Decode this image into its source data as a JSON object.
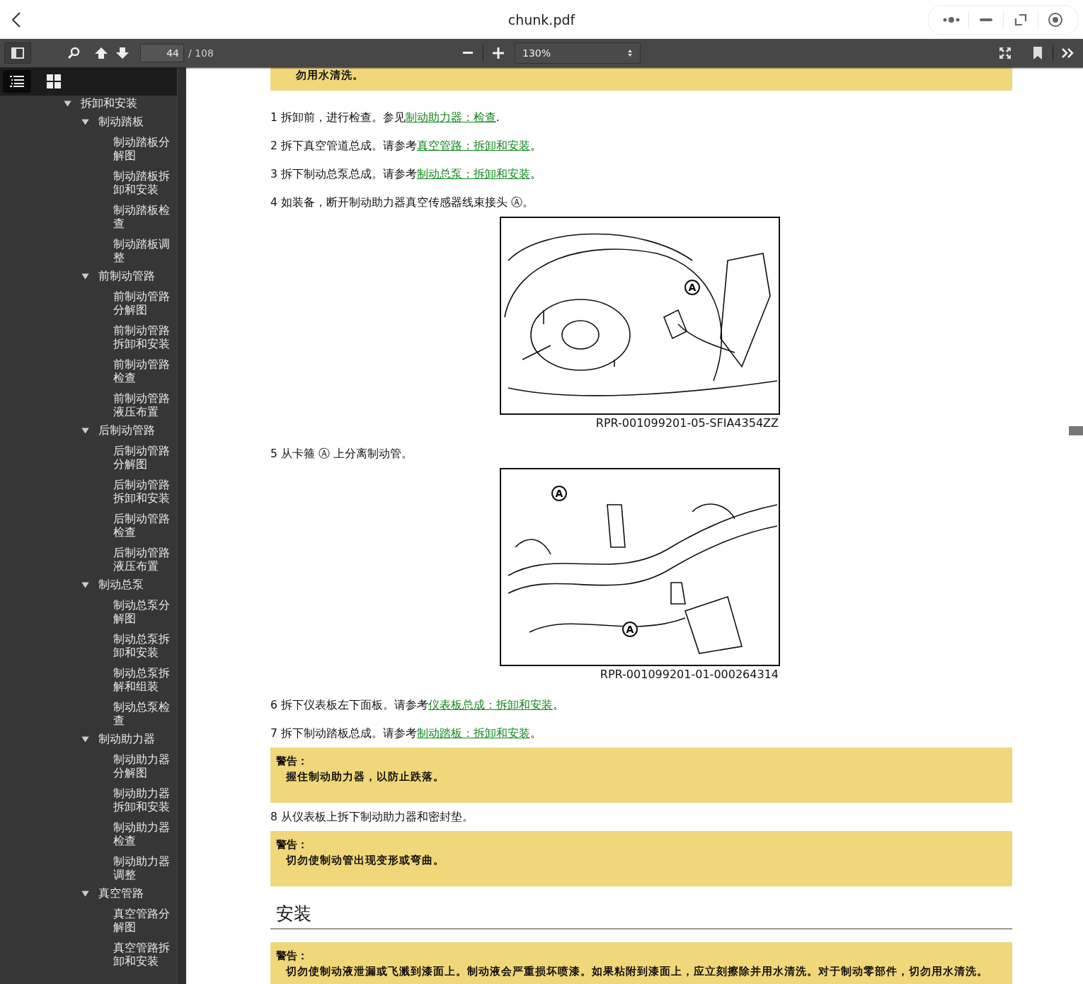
{
  "titlebar": {
    "title": "chunk.pdf"
  },
  "toolbar": {
    "page": "44",
    "page_count": "/ 108",
    "zoom": "130%"
  },
  "sidebar": {
    "tabs": [
      {
        "kind": "outline",
        "selected": true
      },
      {
        "kind": "thumbnails",
        "selected": false
      }
    ],
    "outline": [
      {
        "label": "拆卸和安装",
        "expanded": true,
        "children": [
          {
            "label": "制动踏板",
            "expanded": true,
            "children": [
              {
                "label": "制动踏板分解图"
              },
              {
                "label": "制动踏板拆卸和安装"
              },
              {
                "label": "制动踏板检查"
              },
              {
                "label": "制动踏板调整"
              }
            ]
          },
          {
            "label": "前制动管路",
            "expanded": true,
            "children": [
              {
                "label": "前制动管路分解图"
              },
              {
                "label": "前制动管路拆卸和安装"
              },
              {
                "label": "前制动管路检查"
              },
              {
                "label": "前制动管路液压布置"
              }
            ]
          },
          {
            "label": "后制动管路",
            "expanded": true,
            "children": [
              {
                "label": "后制动管路分解图"
              },
              {
                "label": "后制动管路拆卸和安装"
              },
              {
                "label": "后制动管路检查"
              },
              {
                "label": "后制动管路液压布置"
              }
            ]
          },
          {
            "label": "制动总泵",
            "expanded": true,
            "children": [
              {
                "label": "制动总泵分解图"
              },
              {
                "label": "制动总泵拆卸和安装"
              },
              {
                "label": "制动总泵拆解和组装"
              },
              {
                "label": "制动总泵检查"
              }
            ]
          },
          {
            "label": "制动助力器",
            "expanded": true,
            "children": [
              {
                "label": "制动助力器分解图"
              },
              {
                "label": "制动助力器拆卸和安装"
              },
              {
                "label": "制动助力器检查"
              },
              {
                "label": "制动助力器调整"
              }
            ]
          },
          {
            "label": "真空管路",
            "expanded": true,
            "children": [
              {
                "label": "真空管路分解图"
              },
              {
                "label": "真空管路拆卸和安装"
              }
            ]
          }
        ]
      }
    ]
  },
  "content": [
    {
      "kind": "warning",
      "lines": [
        "勿用水清洗。"
      ]
    },
    {
      "kind": "step",
      "number": "1",
      "text": "拆卸前，进行检查。参见",
      "link": "制动助力器：检查",
      "tail": "."
    },
    {
      "kind": "step",
      "number": "2",
      "text": "拆下真空管道总成。请参考",
      "link": "真空管路：拆卸和安装",
      "tail": "。"
    },
    {
      "kind": "step",
      "number": "3",
      "text": "拆下制动总泵总成。请参考",
      "link": "制动总泵：拆卸和安装",
      "tail": "。"
    },
    {
      "kind": "step",
      "number": "4",
      "text": "如装备，断开制动助力器真空传感器线束接头 Ⓐ。"
    },
    {
      "kind": "figure",
      "callouts": [
        "A"
      ],
      "caption": "RPR-001099201-05-SFIA4354ZZ"
    },
    {
      "kind": "step",
      "number": "5",
      "text": "从卡箍 Ⓐ 上分离制动管。"
    },
    {
      "kind": "figure",
      "callouts": [
        "A",
        "A"
      ],
      "caption": "RPR-001099201-01-000264314"
    },
    {
      "kind": "step",
      "number": "6",
      "text": "拆下仪表板左下面板。请参考",
      "link": "仪表板总成：拆卸和安装",
      "tail": "。"
    },
    {
      "kind": "step",
      "number": "7",
      "text": "拆下制动踏板总成。请参考",
      "link": "制动踏板：拆卸和安装",
      "tail": "。"
    },
    {
      "kind": "warning",
      "title": "警告：",
      "lines": [
        "握住制动助力器，以防止跌落。"
      ]
    },
    {
      "kind": "step",
      "number": "8",
      "text": "从仪表板上拆下制动助力器和密封垫。"
    },
    {
      "kind": "warning",
      "title": "警告：",
      "lines": [
        "切勿使制动管出现变形或弯曲。"
      ]
    },
    {
      "kind": "heading",
      "text": "安装"
    },
    {
      "kind": "warning",
      "title": "警告：",
      "lines": [
        "切勿使制动液泄漏或飞溅到漆面上。制动液会严重损坏喷漆。如果粘附到漆面上，应立刻擦除并用水清洗。对于制动零部件，切勿用水清洗。"
      ]
    }
  ]
}
